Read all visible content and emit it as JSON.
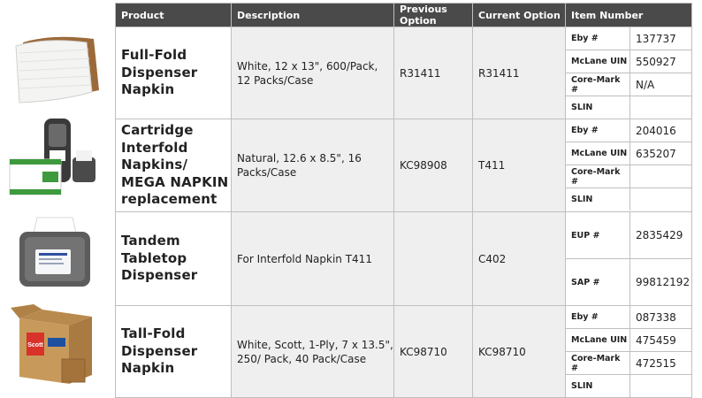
{
  "headers": [
    "Product",
    "Description",
    "Previous Option",
    "Current Option",
    "Item Number"
  ],
  "rows": [
    {
      "product": "Full-Fold Dispenser Napkin",
      "description": "White, 12 x 13\", 600/Pack, 12 Packs/Case",
      "previous": "R31411",
      "current": "R31411",
      "items": [
        {
          "label": "Eby #",
          "value": "137737"
        },
        {
          "label": "McLane UIN",
          "value": "550927"
        },
        {
          "label": "Core-Mark #",
          "value": "N/A"
        },
        {
          "label": "SLIN",
          "value": ""
        }
      ]
    },
    {
      "product": "Cartridge Interfold Napkins/ MEGA NAPKIN replacement",
      "description": "Natural, 12.6 x 8.5\", 16 Packs/Case",
      "previous": "KC98908",
      "current": "T411",
      "items": [
        {
          "label": "Eby #",
          "value": "204016"
        },
        {
          "label": "McLane UIN",
          "value": "635207"
        },
        {
          "label": "Core-Mark #",
          "value": ""
        },
        {
          "label": "SLIN",
          "value": ""
        }
      ]
    },
    {
      "product": "Tandem Tabletop Dispenser",
      "description": "For Interfold Napkin T411",
      "previous": "",
      "current": "C402",
      "items": [
        {
          "label": "EUP #",
          "value": "2835429"
        },
        {
          "label": "SAP #",
          "value": "99812192"
        }
      ]
    },
    {
      "product": "Tall-Fold Dispenser Napkin",
      "description": "White, Scott, 1-Ply, 7 x 13.5\", 250/ Pack, 40 Pack/Case",
      "previous": "KC98710",
      "current": "KC98710",
      "items": [
        {
          "label": "Eby #",
          "value": "087338"
        },
        {
          "label": "McLane UIN",
          "value": "475459"
        },
        {
          "label": "Core-Mark #",
          "value": "472515"
        },
        {
          "label": "SLIN",
          "value": ""
        }
      ]
    }
  ],
  "images": {
    "box_brand_text": "Scott"
  },
  "colors": {
    "header_bg": "#4a4a4a",
    "cell_shade": "#efefef",
    "border": "#bfbfbf"
  }
}
